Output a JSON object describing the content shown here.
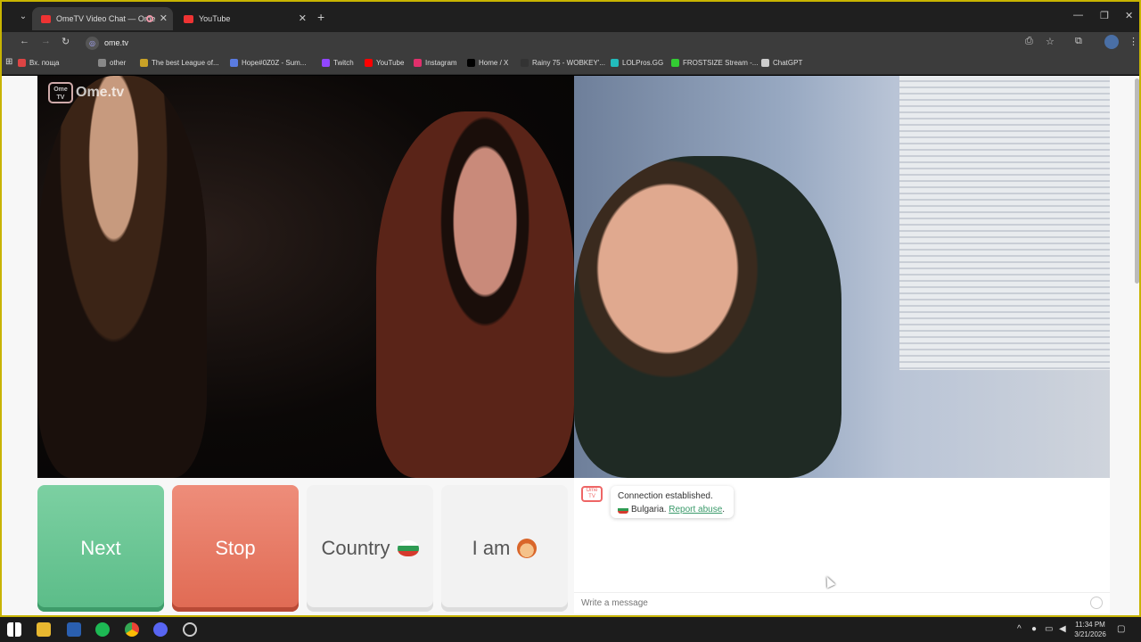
{
  "browser": {
    "tabs": [
      {
        "label": "OmeTV Video Chat — Ome",
        "active": true
      },
      {
        "label": "YouTube",
        "active": false
      }
    ],
    "url": "ome.tv",
    "bookmarks": [
      {
        "label": "Вх. поща",
        "color": "#d44"
      },
      {
        "label": "other",
        "color": "#888"
      },
      {
        "label": "The best League of...",
        "color": "#c9a227"
      },
      {
        "label": "Hope#0Z0Z - Sum...",
        "color": "#5a7be0"
      },
      {
        "label": "Twitch",
        "color": "#9146ff"
      },
      {
        "label": "YouTube",
        "color": "#f00"
      },
      {
        "label": "Instagram",
        "color": "#e1306c"
      },
      {
        "label": "Home / X",
        "color": "#000"
      },
      {
        "label": "Rainy 75 - WOBKEY'...",
        "color": "#333"
      },
      {
        "label": "LOLPros.GG",
        "color": "#2bb"
      },
      {
        "label": "FROSTSIZE Stream -...",
        "color": "#3c3"
      },
      {
        "label": "ChatGPT",
        "color": "#ccc"
      }
    ]
  },
  "page": {
    "logo": "Ome.tv",
    "logo_badge": "Ome TV",
    "controls": {
      "next": "Next",
      "stop": "Stop",
      "country": "Country",
      "iam": "I am"
    },
    "chat": {
      "status": "Connection established.",
      "country": "Bulgaria.",
      "report": "Report abuse",
      "report_suffix": ".",
      "placeholder": "Write a message"
    }
  },
  "taskbar": {
    "time": "11:34 PM",
    "date": "3/21/2026"
  }
}
